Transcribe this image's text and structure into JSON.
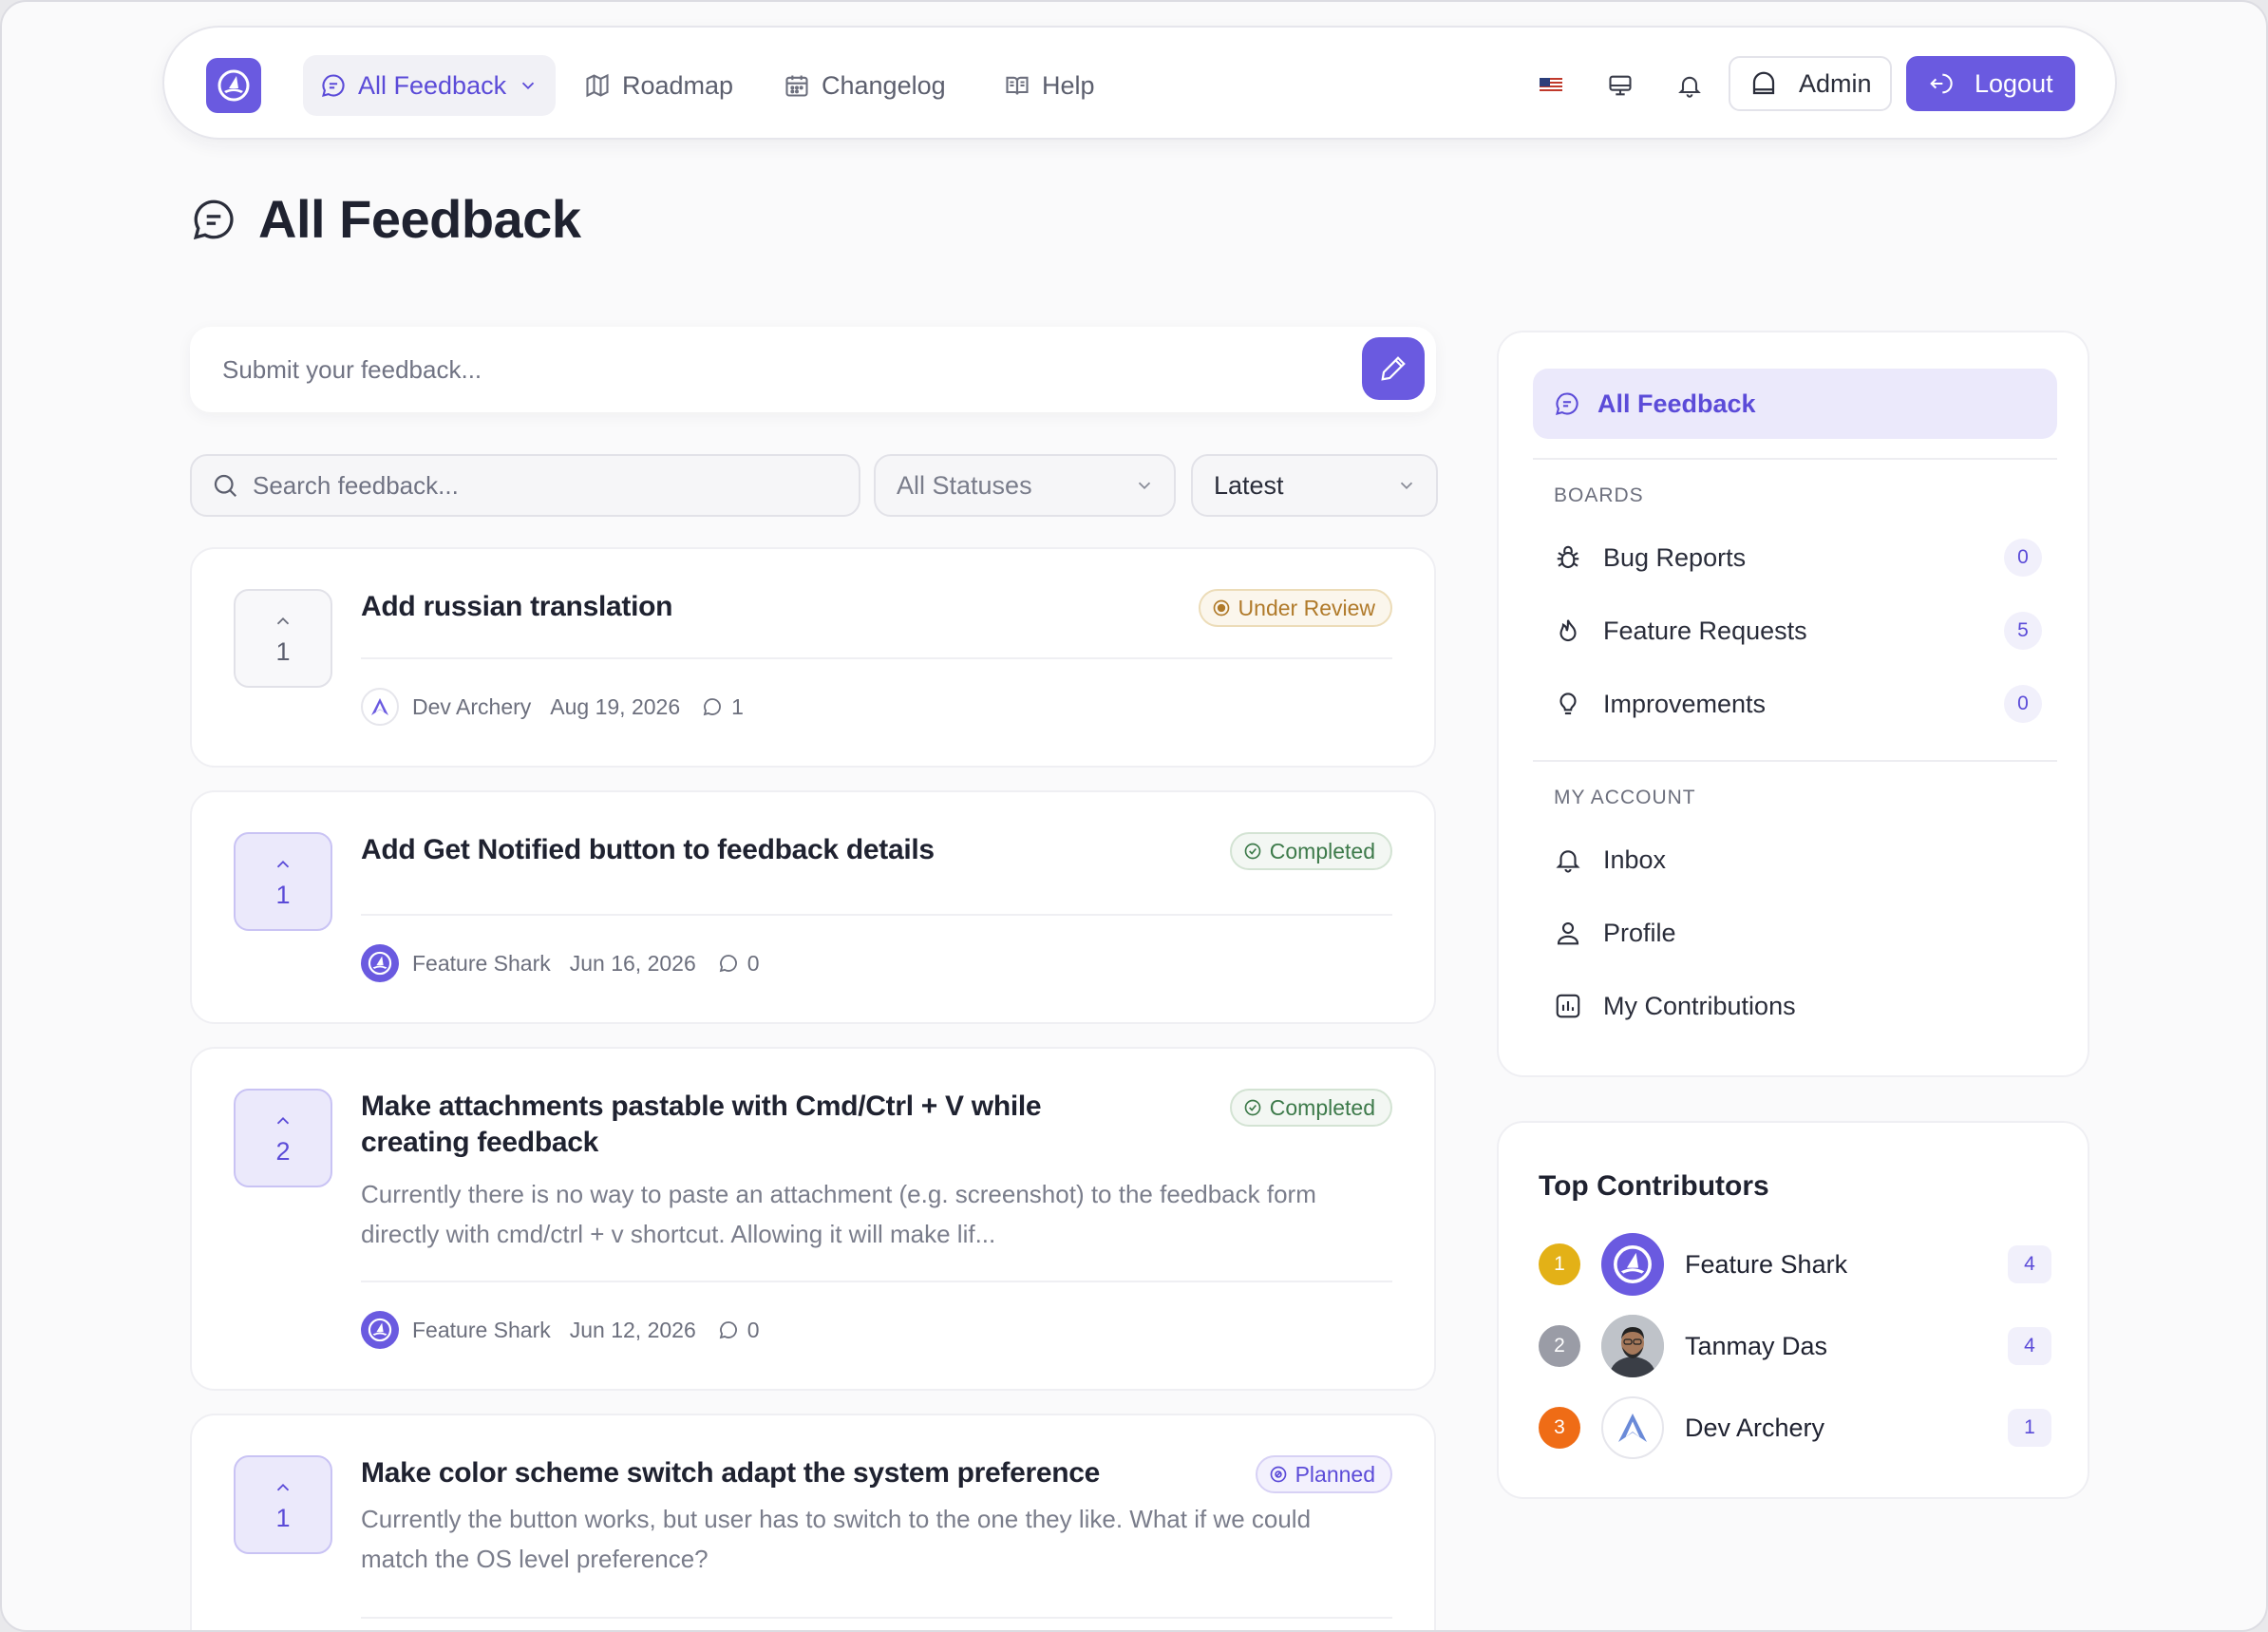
{
  "nav": {
    "items": [
      {
        "label": "All Feedback",
        "icon": "message-circle-icon"
      },
      {
        "label": "Roadmap",
        "icon": "map-icon"
      },
      {
        "label": "Changelog",
        "icon": "calendar-icon"
      },
      {
        "label": "Help",
        "icon": "book-icon"
      }
    ],
    "admin_label": "Admin",
    "logout_label": "Logout"
  },
  "page": {
    "title": "All Feedback"
  },
  "submit": {
    "placeholder": "Submit your feedback..."
  },
  "filters": {
    "search_placeholder": "Search feedback...",
    "status_value": "All Statuses",
    "sort_value": "Latest"
  },
  "feedback": [
    {
      "votes": "1",
      "title": "Add russian translation",
      "status": "Under Review",
      "description": "",
      "author": "Dev Archery",
      "date": "Aug 19, 2026",
      "comments": "1"
    },
    {
      "votes": "1",
      "title": "Add Get Notified button to feedback details",
      "status": "Completed",
      "description": "",
      "author": "Feature Shark",
      "date": "Jun 16, 2026",
      "comments": "0"
    },
    {
      "votes": "2",
      "title": "Make attachments pastable with Cmd/Ctrl + V while creating feedback",
      "status": "Completed",
      "description": "Currently there is no way to paste an attachment (e.g. screenshot) to the feedback form directly with cmd/ctrl + v shortcut. Allowing it will make lif...",
      "author": "Feature Shark",
      "date": "Jun 12, 2026",
      "comments": "0"
    },
    {
      "votes": "1",
      "title": "Make color scheme switch adapt the system preference",
      "status": "Planned",
      "description": "Currently the button works, but user has to switch to the one they like. What if we could match the OS level preference?",
      "author": "",
      "date": "",
      "comments": ""
    }
  ],
  "sidebar": {
    "active_label": "All Feedback",
    "boards_heading": "BOARDS",
    "boards": [
      {
        "label": "Bug Reports",
        "count": "0",
        "icon": "bug-icon"
      },
      {
        "label": "Feature Requests",
        "count": "5",
        "icon": "flame-icon"
      },
      {
        "label": "Improvements",
        "count": "0",
        "icon": "lightbulb-icon"
      }
    ],
    "account_heading": "MY ACCOUNT",
    "account": [
      {
        "label": "Inbox",
        "icon": "bell-icon"
      },
      {
        "label": "Profile",
        "icon": "user-icon"
      },
      {
        "label": "My Contributions",
        "icon": "chart-icon"
      }
    ]
  },
  "contributors": {
    "title": "Top Contributors",
    "list": [
      {
        "rank": "1",
        "name": "Feature Shark",
        "count": "4",
        "rank_color": "#e3b117"
      },
      {
        "rank": "2",
        "name": "Tanmay Das",
        "count": "4",
        "rank_color": "#9a9ca6"
      },
      {
        "rank": "3",
        "name": "Dev Archery",
        "count": "1",
        "rank_color": "#ef6c16"
      }
    ]
  },
  "colors": {
    "accent": "#6a5ae0",
    "accent_light": "#ebe9fb"
  }
}
